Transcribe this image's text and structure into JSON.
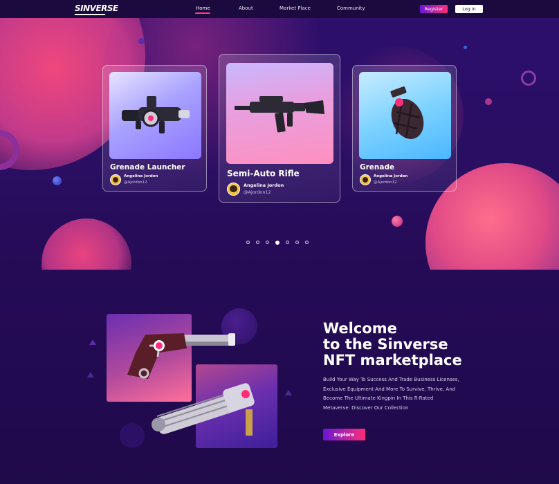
{
  "brand": {
    "logo": "SINVERSE"
  },
  "nav": {
    "links": [
      {
        "label": "Home",
        "active": true
      },
      {
        "label": "About"
      },
      {
        "label": "Market Place"
      },
      {
        "label": "Community"
      }
    ],
    "register": "Register",
    "login": "Log in"
  },
  "hero": {
    "cards": [
      {
        "title": "Grenade Launcher",
        "author": "Angelina Jordon",
        "handle": "@Ajordon12",
        "icon": "grenade-launcher-icon"
      },
      {
        "title": "Semi-Auto Rifle",
        "author": "Angelina Jordon",
        "handle": "@Ajordon12",
        "icon": "rifle-icon"
      },
      {
        "title": "Grenade",
        "author": "Angelina Jordon",
        "handle": "@Ajordon12",
        "icon": "grenade-icon"
      }
    ],
    "slider": {
      "count": 7,
      "active": 4
    }
  },
  "welcome": {
    "heading_line1": "Welcome",
    "heading_line2": "to the Sinverse",
    "heading_line3": "NFT marketplace",
    "description": "Build Your Way To Success And Trade Business Licenses, Exclusive Equipment And More To Survive, Thrive, And Become The Ultimate Kingpin In This R-Rated Metaverse. Discover Our Collection",
    "explore": "Explore"
  },
  "colors": {
    "accent_pink": "#ff2d78",
    "accent_purple": "#6a17d4",
    "background": "#1f0b4a"
  }
}
